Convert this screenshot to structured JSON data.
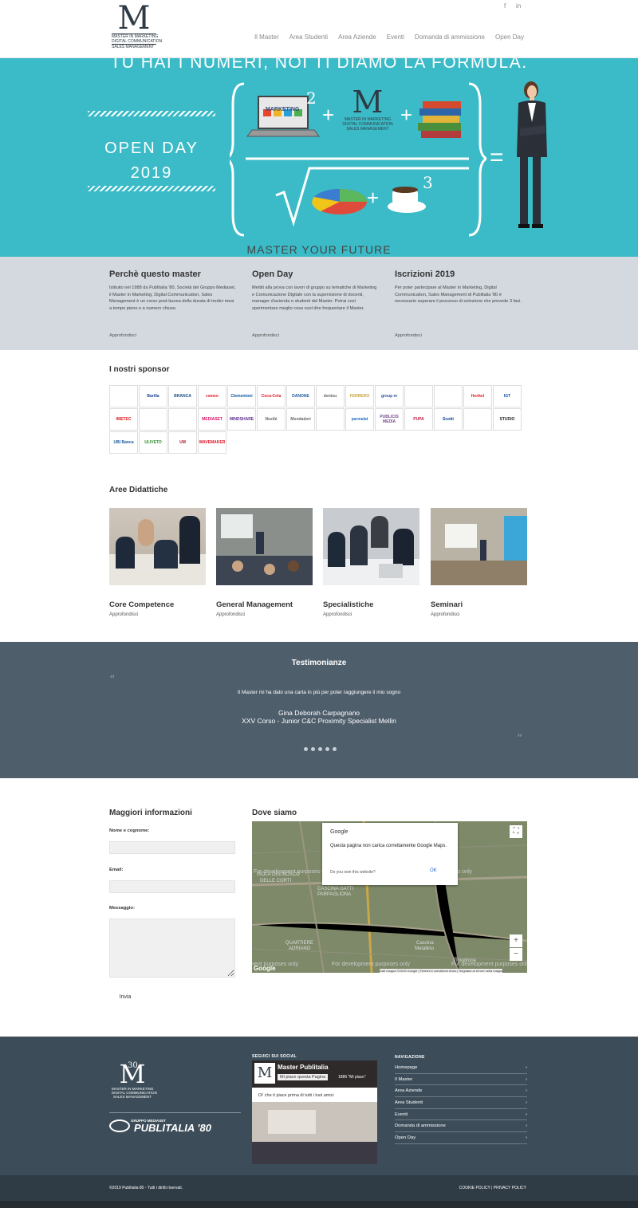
{
  "header": {
    "social": [
      "f",
      "in"
    ],
    "logo_mark": "M",
    "logo_lines": [
      "MASTER IN MARKETING",
      "DIGITAL COMMUNICATION",
      "SALES MANAGEMENT"
    ],
    "nav": [
      "Il Master",
      "Area Studenti",
      "Area Aziende",
      "Eventi",
      "Domanda di ammissione",
      "Open Day"
    ]
  },
  "hero": {
    "title": "TU HAI I NUMERI, NOI TI DIAMO LA FORMULA.",
    "open_day": "OPEN DAY",
    "year": "2019",
    "laptop_label": "MARKETING",
    "exp2": "2",
    "exp3": "3",
    "plus": "+",
    "equals": "=",
    "footer": "MASTER YOUR FUTURE"
  },
  "info": [
    {
      "title": "Perchè questo master",
      "text": "Istituito nel 1988 da Publitalia '80, Società del Gruppo Mediaset, il Master in Marketing, Digital Communication, Sales Management è un corso post-laurea della durata di tredici mesi a tempo pieno e a numero chiuso.",
      "more": "Approfondisci"
    },
    {
      "title": "Open Day",
      "text": "Mettiti alla prova con lavori di gruppo su tematiche di Marketing e Comunicazione Digitale con la supervisione di docenti, manager d'azienda e studenti del Master. Potrai così sperimentare meglio cosa vuol dire frequentare il Master.",
      "more": "Approfondisci"
    },
    {
      "title": "Iscrizioni 2019",
      "text": "Per poter partecipare al Master in Marketing, Digital Communication, Sales Management di Publitalia '80 è necessario superare il processo di selezione che prevede 3 fasi.",
      "more": "Approfondisci"
    }
  ],
  "sponsors_title": "I nostri sponsor",
  "sponsors": [
    "",
    "Barilla",
    "BRANCA",
    "cameo",
    "Clementoni",
    "Coca-Cola",
    "DANONE",
    "dentsu",
    "FERRERO",
    "group m",
    "",
    "",
    "Henkel",
    "IGT",
    "IMETEC",
    "",
    "",
    "MEDIASET",
    "MINDSHARE",
    "Nestlé",
    "Mondadori",
    "",
    "parmalat",
    "PUBLICIS MEDIA",
    "PUPA",
    "Scotti",
    "",
    "STUDIO",
    "UBI Banca",
    "ULIVETO",
    "UM",
    "WAVEMAKER"
  ],
  "aree_title": "Aree Didattiche",
  "aree": [
    {
      "title": "Core Competence",
      "more": "Approfondisci"
    },
    {
      "title": "General Management",
      "more": "Approfondisci"
    },
    {
      "title": "Specialistiche",
      "more": "Approfondisci"
    },
    {
      "title": "Seminari",
      "more": "Approfondisci"
    }
  ],
  "testimonials": {
    "title": "Testimonianze",
    "quote_open": "“",
    "quote_close": "”",
    "text": "Il Master mi ha dato una carta in più per poter raggiungere il mio sogno",
    "name": "Gina Deborah Carpagnano",
    "role": "XXV Corso - Junior C&C Proximity Specialist Mellin",
    "dots": 5
  },
  "contact": {
    "title": "Maggiori informazioni",
    "name_label": "Nome e cognome:",
    "email_label": "Email:",
    "message_label": "Messaggio:",
    "send": "Invia"
  },
  "map": {
    "title": "Dove siamo",
    "google": "Google",
    "message": "Questa pagina non carica correttamente Google Maps.",
    "question": "Do you own this website?",
    "ok": "OK",
    "dev_text": "For development purposes only",
    "places": [
      "ISOLA DEL BOSCO",
      "DELLE CORTI",
      "CASCINA GATTI",
      "PARPAGLIONA",
      "QUARTIERE",
      "ADRIANO",
      "Cascina",
      "Metallino",
      "Vimodrone"
    ],
    "attribution": "Dati mappa ©2019 Google | Termini e condizioni d'uso | Segnala un errore nella mappa",
    "zoom_in": "+",
    "zoom_out": "−"
  },
  "footer": {
    "logo_mark": "M",
    "logo_badge": "30",
    "logo_lines": [
      "MASTER IN MARKETING",
      "DIGITAL COMMUNICATION",
      "SALES MANAGEMENT"
    ],
    "group_line": "GRUPPO MEDIASET",
    "publitalia": "PUBLITALIA '80",
    "social_title": "SEGUICI SUI SOCIAL",
    "fb_page": "Master Publitalia",
    "fb_like": "Mi piace questa Pagina",
    "fb_count": "1886 \"Mi piace\"",
    "fb_friends": "Di' che ti piace prima di tutti i tuoi amici",
    "nav_title": "NAVIGAZIONE",
    "nav": [
      "Homepage",
      "Il Master",
      "Area Aziende",
      "Area Studenti",
      "Eventi",
      "Domanda di ammissione",
      "Open Day"
    ],
    "nav_arrow": "›",
    "copyright": "©2019 Publitalia 80 - Tutti i diritti riservati.",
    "policy": "COOKIE POLICY | PRIVACY POLICY"
  }
}
